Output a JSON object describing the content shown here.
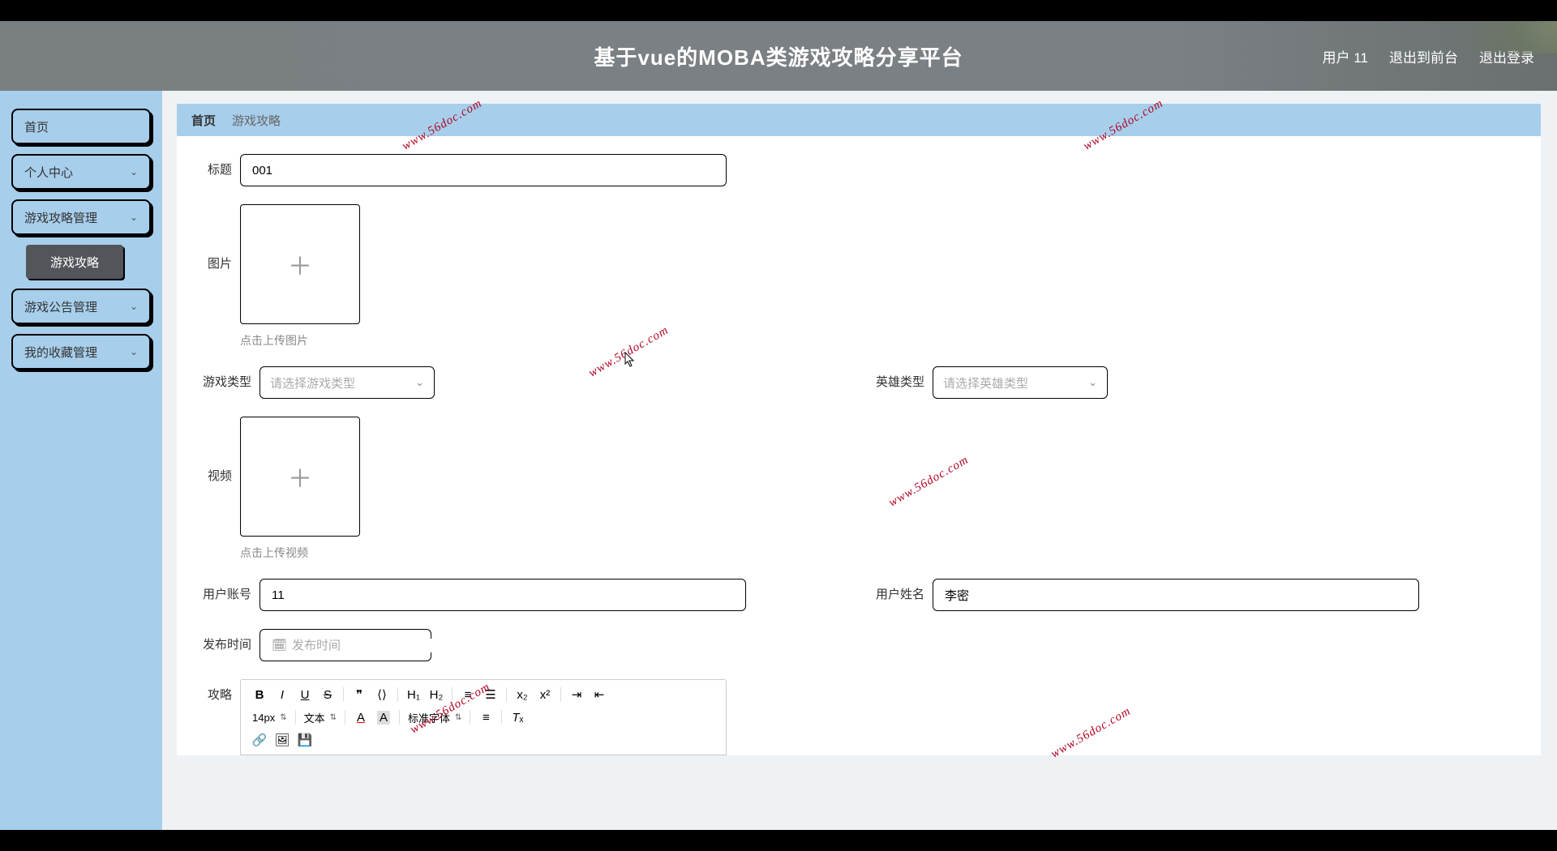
{
  "header": {
    "title": "基于vue的MOBA类游戏攻略分享平台",
    "user_label": "用户 11",
    "front_label": "退出到前台",
    "logout_label": "退出登录"
  },
  "sidebar": {
    "items": [
      {
        "label": "首页"
      },
      {
        "label": "个人中心"
      },
      {
        "label": "游戏攻略管理"
      },
      {
        "label": "游戏公告管理"
      },
      {
        "label": "我的收藏管理"
      }
    ],
    "sub_item": "游戏攻略"
  },
  "breadcrumb": {
    "home": "首页",
    "current": "游戏攻略"
  },
  "form": {
    "title_label": "标题",
    "title_value": "001",
    "image_label": "图片",
    "image_hint": "点击上传图片",
    "game_type_label": "游戏类型",
    "game_type_placeholder": "请选择游戏类型",
    "hero_type_label": "英雄类型",
    "hero_type_placeholder": "请选择英雄类型",
    "video_label": "视频",
    "video_hint": "点击上传视频",
    "account_label": "用户账号",
    "account_value": "11",
    "name_label": "用户姓名",
    "name_value": "李密",
    "publish_label": "发布时间",
    "publish_placeholder": "发布时间",
    "strategy_label": "攻略"
  },
  "editor": {
    "font_size": "14px",
    "block_type": "文本",
    "font_family": "标准字体"
  },
  "watermark_text": "www.56doc.com"
}
